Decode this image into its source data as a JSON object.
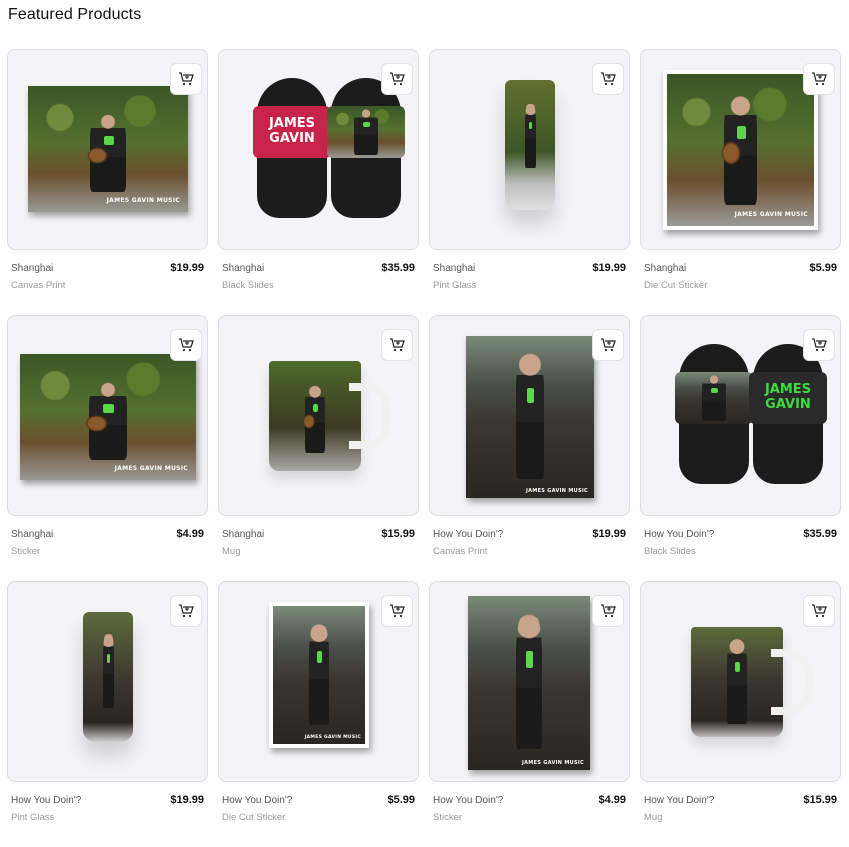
{
  "section": {
    "title": "Featured Products"
  },
  "products": [
    {
      "name": "Shanghai",
      "type": "Canvas Print",
      "price": "$19.99",
      "caption": "JAMES GAVIN MUSIC"
    },
    {
      "name": "Shanghai",
      "type": "Black Slides",
      "price": "$35.99",
      "slide_text": "JAMES GAVIN"
    },
    {
      "name": "Shanghai",
      "type": "Pint Glass",
      "price": "$19.99"
    },
    {
      "name": "Shanghai",
      "type": "Die Cut Sticker",
      "price": "$5.99",
      "caption": "JAMES GAVIN MUSIC"
    },
    {
      "name": "Shanghai",
      "type": "Sticker",
      "price": "$4.99",
      "caption": "JAMES GAVIN MUSIC"
    },
    {
      "name": "Shanghai",
      "type": "Mug",
      "price": "$15.99"
    },
    {
      "name": "How You Doin'?",
      "type": "Canvas Print",
      "price": "$19.99",
      "caption": "JAMES GAVIN MUSIC"
    },
    {
      "name": "How You Doin'?",
      "type": "Black Slides",
      "price": "$35.99",
      "slide_text": "JAMES GAVIN"
    },
    {
      "name": "How You Doin'?",
      "type": "Pint Glass",
      "price": "$19.99"
    },
    {
      "name": "How You Doin'?",
      "type": "Die Cut Sticker",
      "price": "$5.99",
      "caption": "JAMES GAVIN MUSIC"
    },
    {
      "name": "How You Doin'?",
      "type": "Sticker",
      "price": "$4.99",
      "caption": "JAMES GAVIN MUSIC"
    },
    {
      "name": "How You Doin'?",
      "type": "Mug",
      "price": "$15.99"
    }
  ],
  "icons": {
    "add_to_cart": "add-to-cart-icon"
  },
  "colors": {
    "card_bg": "#f4f4f7",
    "card_border": "#dcdce2",
    "slide_strap_red": "#c8234a",
    "slide_text_green": "#3ddc3a"
  }
}
